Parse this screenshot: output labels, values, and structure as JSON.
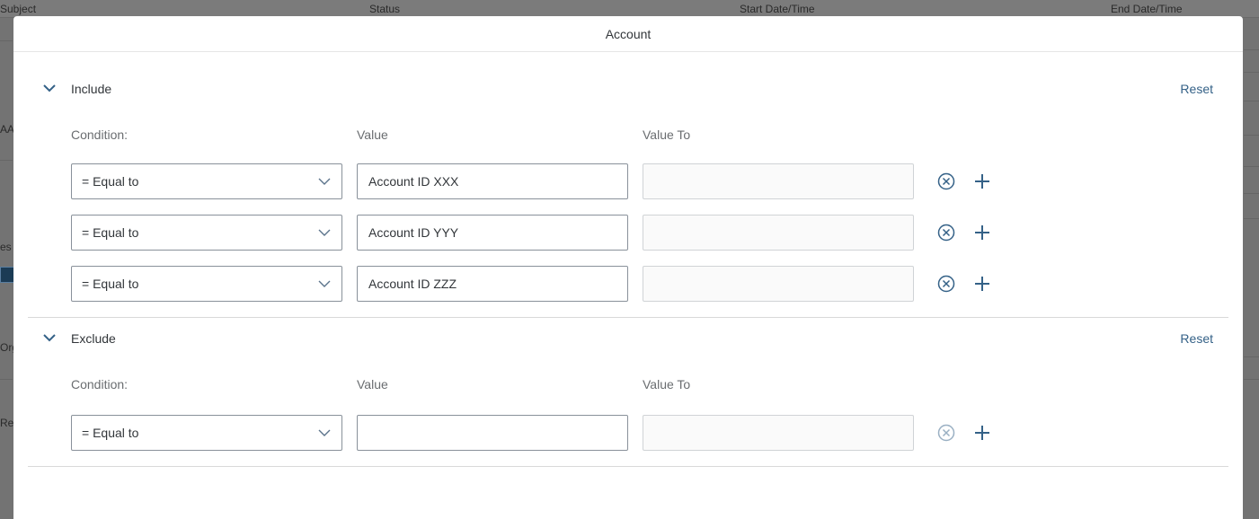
{
  "background": {
    "columns": [
      "Subject",
      "Status",
      "Start Date/Time",
      "End Date/Time"
    ],
    "fragments": [
      "AA",
      "es",
      "Org",
      "Res"
    ]
  },
  "dialog": {
    "title": "Account",
    "include": {
      "title": "Include",
      "reset_label": "Reset",
      "labels": {
        "condition": "Condition:",
        "value": "Value",
        "value_to": "Value To"
      },
      "rows": [
        {
          "condition": "= Equal to",
          "value": "Account ID XXX",
          "value_to": "",
          "remove_enabled": true
        },
        {
          "condition": "= Equal to",
          "value": "Account ID YYY",
          "value_to": "",
          "remove_enabled": true
        },
        {
          "condition": "= Equal to",
          "value": "Account ID ZZZ",
          "value_to": "",
          "remove_enabled": true
        }
      ]
    },
    "exclude": {
      "title": "Exclude",
      "reset_label": "Reset",
      "labels": {
        "condition": "Condition:",
        "value": "Value",
        "value_to": "Value To"
      },
      "rows": [
        {
          "condition": "= Equal to",
          "value": "",
          "value_to": "",
          "remove_enabled": false
        }
      ]
    }
  },
  "icons": {
    "expand": "chevron-down-icon",
    "dropdown": "chevron-down-icon",
    "remove": "circle-x-icon",
    "add": "plus-icon"
  },
  "colors": {
    "accent": "#346187",
    "icon": "#346187",
    "icon_disabled": "#9ab0c3"
  }
}
